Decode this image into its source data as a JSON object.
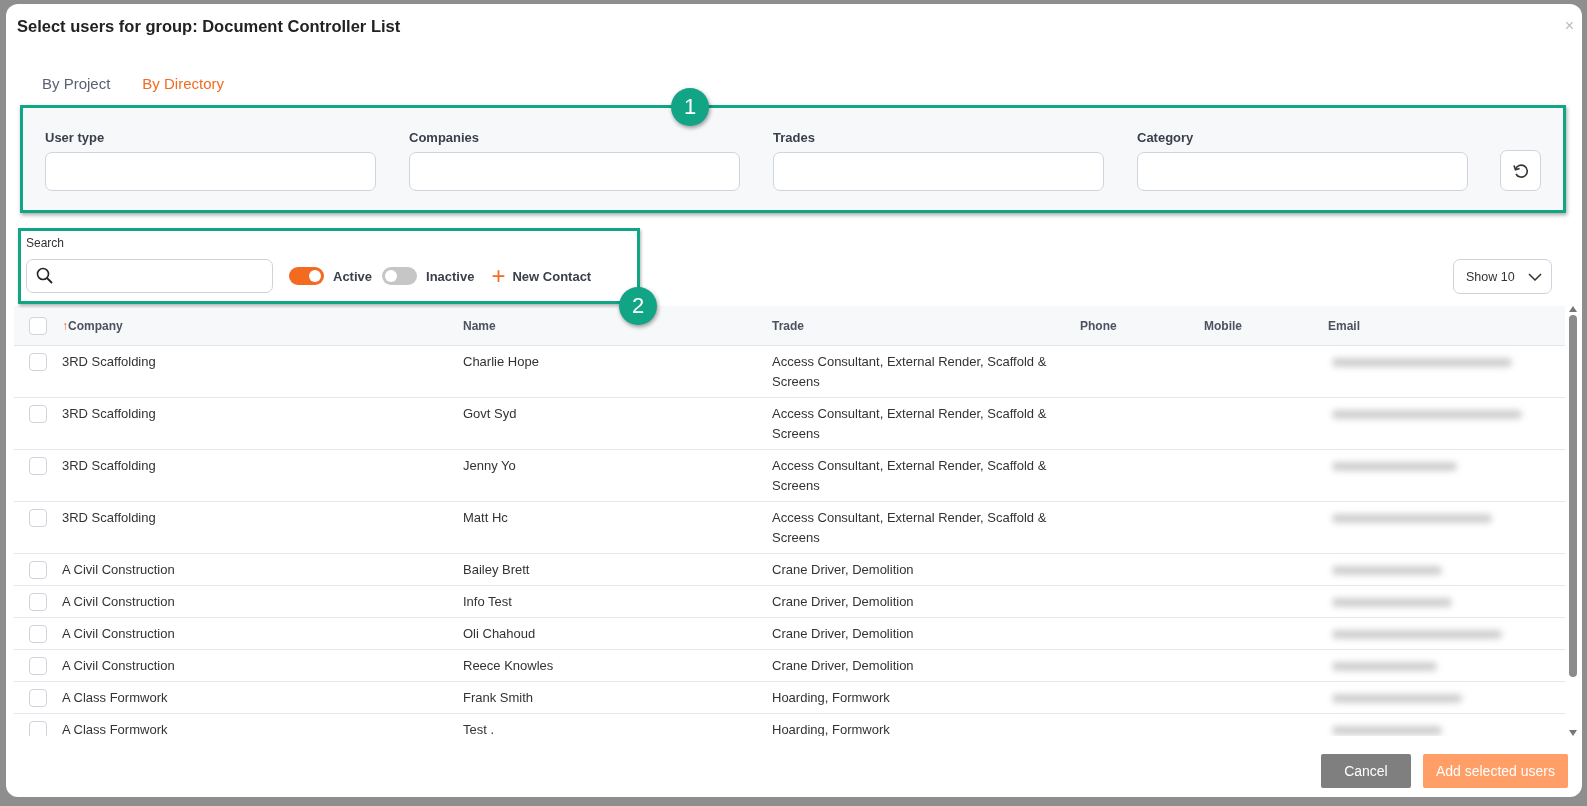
{
  "dialog": {
    "title": "Select users for group: Document Controller List",
    "close": "×"
  },
  "tabs": [
    {
      "label": "By Project",
      "selected": false
    },
    {
      "label": "By Directory",
      "selected": true
    }
  ],
  "filters": [
    {
      "label": "User type"
    },
    {
      "label": "Companies"
    },
    {
      "label": "Trades"
    },
    {
      "label": "Category"
    }
  ],
  "search": {
    "label": "Search"
  },
  "toggles": [
    {
      "label": "Active",
      "on": true
    },
    {
      "label": "Inactive",
      "on": false
    }
  ],
  "new_contact": {
    "icon": "+",
    "label": "New Contact"
  },
  "page_size": {
    "value": "Show 10"
  },
  "annotations": [
    {
      "label": "1"
    },
    {
      "label": "2"
    }
  ],
  "table": {
    "select_all_checked": false,
    "columns": [
      {
        "label": "Company",
        "sort_icon": "↑"
      },
      {
        "label": "Name"
      },
      {
        "label": "Trade"
      },
      {
        "label": "Phone"
      },
      {
        "label": "Mobile"
      },
      {
        "label": "Email"
      }
    ],
    "rows": [
      {
        "checked": false,
        "company": "3RD Scaffolding",
        "name": "Charlie Hope",
        "trade": "Access Consultant, External Render, Scaffold & Screens"
      },
      {
        "checked": false,
        "company": "3RD Scaffolding",
        "name": "Govt Syd",
        "trade": "Access Consultant, External Render, Scaffold & Screens"
      },
      {
        "checked": false,
        "company": "3RD Scaffolding",
        "name": "Jenny Yo",
        "trade": "Access Consultant, External Render, Scaffold & Screens"
      },
      {
        "checked": false,
        "company": "3RD Scaffolding",
        "name": "Matt Hc",
        "trade": "Access Consultant, External Render, Scaffold & Screens"
      },
      {
        "checked": false,
        "company": "A Civil Construction",
        "name": "Bailey Brett",
        "trade": "Crane Driver, Demolition"
      },
      {
        "checked": false,
        "company": "A Civil Construction",
        "name": "Info Test",
        "trade": "Crane Driver, Demolition"
      },
      {
        "checked": false,
        "company": "A Civil Construction",
        "name": "Oli Chahoud",
        "trade": "Crane Driver, Demolition"
      },
      {
        "checked": false,
        "company": "A Civil Construction",
        "name": "Reece Knowles",
        "trade": "Crane Driver, Demolition"
      },
      {
        "checked": false,
        "company": "A Class Formwork",
        "name": "Frank Smith",
        "trade": "Hoarding, Formwork"
      },
      {
        "checked": false,
        "company": "A Class Formwork",
        "name": "Test .",
        "trade": "Hoarding, Formwork"
      }
    ]
  },
  "buttons": [
    {
      "kind": "secondary",
      "label": "Cancel"
    },
    {
      "kind": "primary",
      "label": "Add selected users"
    }
  ]
}
